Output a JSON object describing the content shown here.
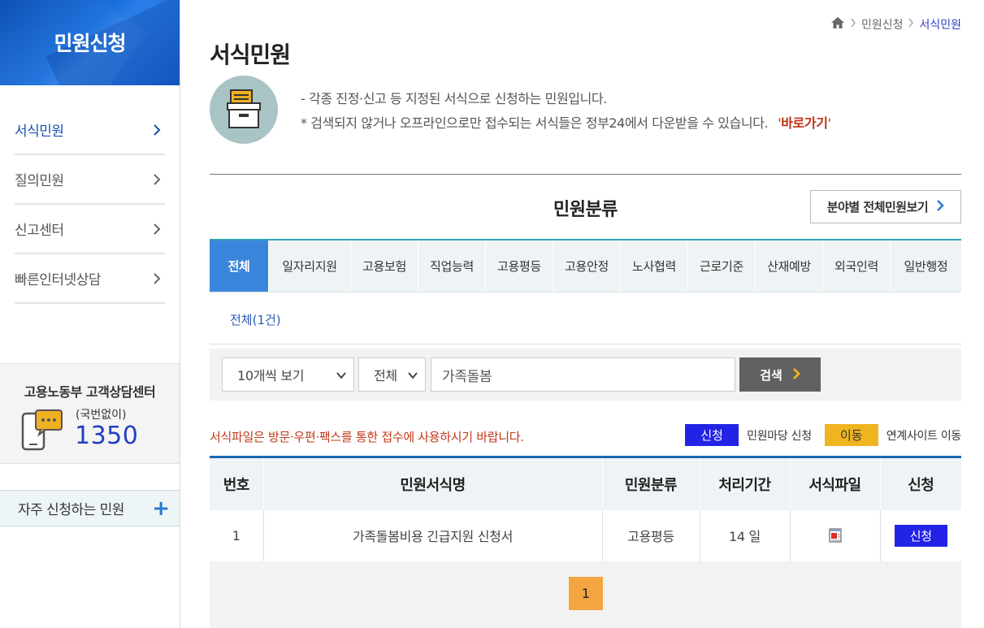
{
  "sidebar": {
    "title": "민원신청",
    "items": [
      {
        "label": "서식민원"
      },
      {
        "label": "질의민원"
      },
      {
        "label": "신고센터"
      },
      {
        "label": "빠른인터넷상담"
      }
    ],
    "center": {
      "title": "고용노동부 고객상담센터",
      "sub": "(국번없이)",
      "number": "1350"
    },
    "frequent": {
      "label": "자주 신청하는 민원",
      "plus": "+"
    }
  },
  "breadcrumb": {
    "items": [
      "민원신청",
      "서식민원"
    ]
  },
  "page": {
    "title": "서식민원"
  },
  "intro": {
    "line1": "- 각종 진정·신고 등 지정된 서식으로 신청하는 민원입니다.",
    "line2": "* 검색되지 않거나 오프라인으로만 접수되는 서식들은 정부24에서 다운받을 수 있습니다.",
    "link_open": "'",
    "link_text": "바로가기",
    "link_close": "'"
  },
  "category": {
    "heading": "민원분류",
    "all_button": "분야별 전체민원보기",
    "tabs": [
      "전체",
      "일자리지원",
      "고용보험",
      "직업능력",
      "고용평등",
      "고용안정",
      "노사협력",
      "근로기준",
      "산재예방",
      "외국인력",
      "일반행정"
    ],
    "active_tab": 0,
    "count_label": "전체(1건)"
  },
  "search": {
    "per_page": "10개씩 보기",
    "scope": "전체",
    "query": "가족돌봄",
    "button": "검색"
  },
  "notice": "서식파일은 방문·우편·팩스를 통한 접수에 사용하시기 바랍니다.",
  "legend": {
    "apply_badge": "신청",
    "apply_text": "민원마당 신청",
    "move_badge": "이동",
    "move_text": "연계사이트 이동"
  },
  "table": {
    "headers": [
      "번호",
      "민원서식명",
      "민원분류",
      "처리기간",
      "서식파일",
      "신청"
    ],
    "rows": [
      {
        "no": "1",
        "name": "가족돌봄비용 긴급지원 신청서",
        "category": "고용평등",
        "period": "14 일",
        "file_icon": "document-file-icon",
        "apply": "신청"
      }
    ]
  },
  "pagination": {
    "current": "1"
  },
  "colors": {
    "accent": "#3a86dc",
    "apply_blue": "#2323e6",
    "move_yellow": "#efb420",
    "page_orange": "#f5a442",
    "notice_red": "#c03a1a"
  }
}
